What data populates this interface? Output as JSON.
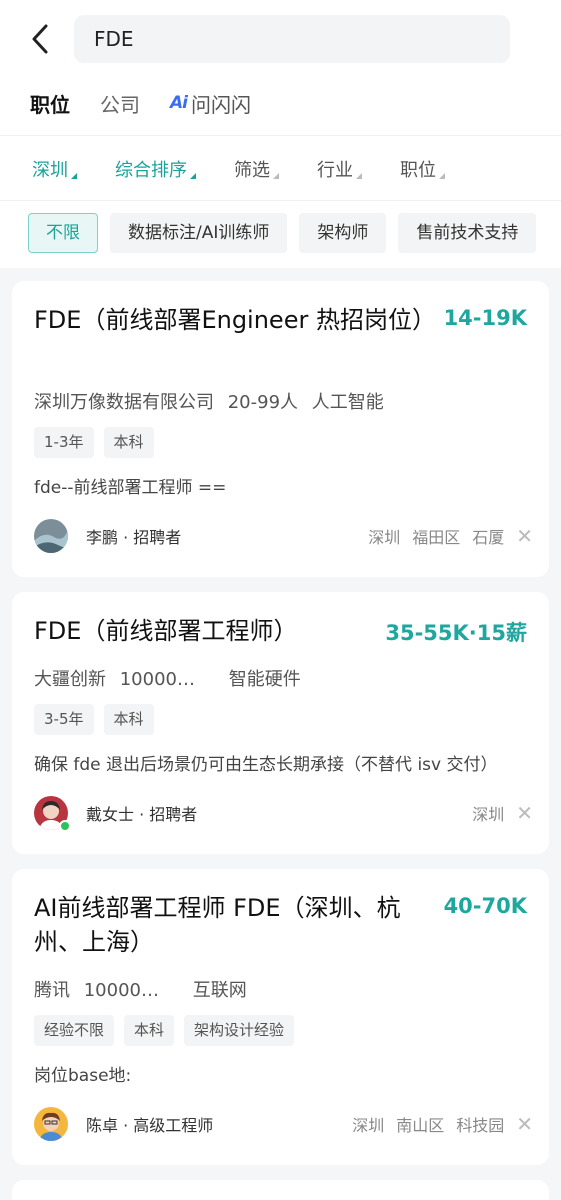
{
  "search": {
    "query": "FDE"
  },
  "tabs": [
    {
      "label": "职位"
    },
    {
      "label": "公司"
    },
    {
      "label": "问闪闪",
      "logo": "Ai"
    }
  ],
  "filters": [
    {
      "label": "深圳"
    },
    {
      "label": "综合排序"
    },
    {
      "label": "筛选"
    },
    {
      "label": "行业"
    },
    {
      "label": "职位"
    }
  ],
  "chips": [
    {
      "label": "不限"
    },
    {
      "label": "数据标注/AI训练师"
    },
    {
      "label": "架构师"
    },
    {
      "label": "售前技术支持"
    }
  ],
  "jobs": [
    {
      "title": "FDE（前线部署Engineer  热招岗位）",
      "salary": "14-19K",
      "company": "深圳万像数据有限公司",
      "size": "20-99人",
      "industry": "人工智能",
      "tags": [
        "1-3年",
        "本科"
      ],
      "desc": "fde--前线部署工程师  ==",
      "recruiter": "李鹏 · 招聘者",
      "location": [
        "深圳",
        "福田区",
        "石厦"
      ]
    },
    {
      "title": "FDE（前线部署工程师）",
      "salary": "35-55K·15薪",
      "company": "大疆创新",
      "size": "10000…",
      "industry": "智能硬件",
      "tags": [
        "3-5年",
        "本科"
      ],
      "desc": "确保 fde 退出后场景仍可由生态长期承接（不替代 isv 交付）",
      "recruiter": "戴女士 · 招聘者",
      "location": [
        "深圳"
      ]
    },
    {
      "title": "AI前线部署工程师 FDE（深圳、杭州、上海）",
      "salary": "40-70K",
      "company": "腾讯",
      "size": "10000…",
      "industry": "互联网",
      "tags": [
        "经验不限",
        "本科",
        "架构设计经验"
      ],
      "desc": "岗位base地:",
      "recruiter": "陈卓 · 高级工程师",
      "location": [
        "深圳",
        "南山区",
        "科技园"
      ]
    }
  ],
  "colors": {
    "accent": "#1aa39a",
    "salary": "#1ea79e",
    "ai_logo": "#3b6cf3"
  }
}
